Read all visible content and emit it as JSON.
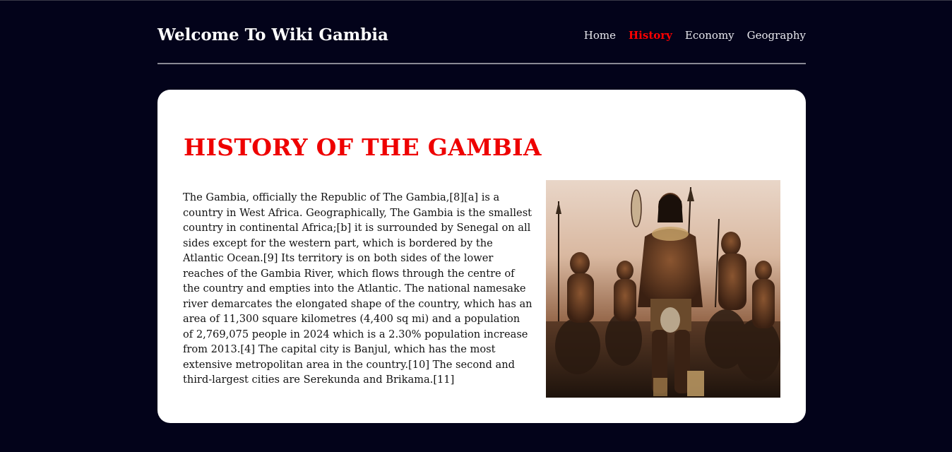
{
  "site": {
    "title": "Welcome To Wiki Gambia"
  },
  "nav": {
    "items": [
      {
        "label": "Home",
        "active": false
      },
      {
        "label": "History",
        "active": true
      },
      {
        "label": "Economy",
        "active": false
      },
      {
        "label": "Geography",
        "active": false
      }
    ]
  },
  "main": {
    "heading": "HISTORY OF THE GAMBIA",
    "paragraph": "The Gambia, officially the Republic of The Gambia,[8][a] is a country in West Africa. Geographically, The Gambia is the smallest country in continental Africa;[b] it is surrounded by Senegal on all sides except for the western part, which is bordered by the Atlantic Ocean.[9] Its territory is on both sides of the lower reaches of the Gambia River, which flows through the centre of the country and empties into the Atlantic. The national namesake river demarcates the elongated shape of the country, which has an area of 11,300 square kilometres (4,400 sq mi) and a population of 2,769,075 people in 2024 which is a 2.30% population increase from 2013.[4] The capital city is Banjul, which has the most extensive metropolitan area in the country.[10] The second and third-largest cities are Serekunda and Brikama.[11]"
  },
  "colors": {
    "background": "#03031a",
    "accent": "#ee0000",
    "card": "#ffffff"
  }
}
